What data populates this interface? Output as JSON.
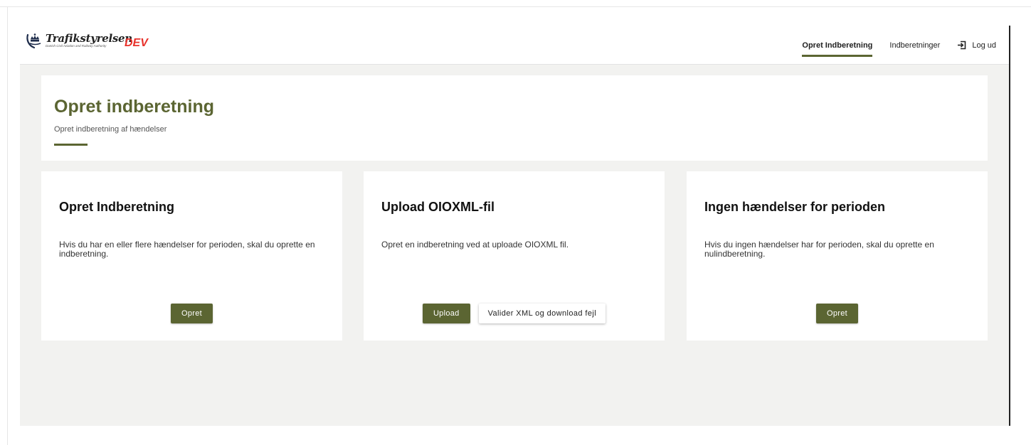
{
  "header": {
    "logo_name": "Trafikstyrelsen",
    "logo_subtitle": "Danish Civil Aviation and Railway Authority",
    "env_badge": "DEV",
    "nav": {
      "create": "Opret Indberetning",
      "reports": "Indberetninger",
      "logout": "Log ud"
    }
  },
  "page": {
    "title": "Opret indberetning",
    "subtitle": "Opret indberetning af hændelser"
  },
  "cards": [
    {
      "title": "Opret Indberetning",
      "text": "Hvis du har en eller flere hændelser for perioden, skal du oprette en indberetning.",
      "button": "Opret"
    },
    {
      "title": "Upload OIOXML-fil",
      "text": "Opret en indberetning ved at uploade OIOXML fil.",
      "button": "Upload",
      "secondary_button": "Valider XML og download fejl"
    },
    {
      "title": "Ingen hændelser for perioden",
      "text": "Hvis du ingen hændelser har for perioden, skal du oprette en nulindberetning.",
      "button": "Opret"
    }
  ],
  "colors": {
    "accent": "#5b6532",
    "env_badge": "#e8322b",
    "background": "#f2f2f0"
  },
  "icons": {
    "logo": "crown-icon",
    "logout": "logout-icon"
  }
}
